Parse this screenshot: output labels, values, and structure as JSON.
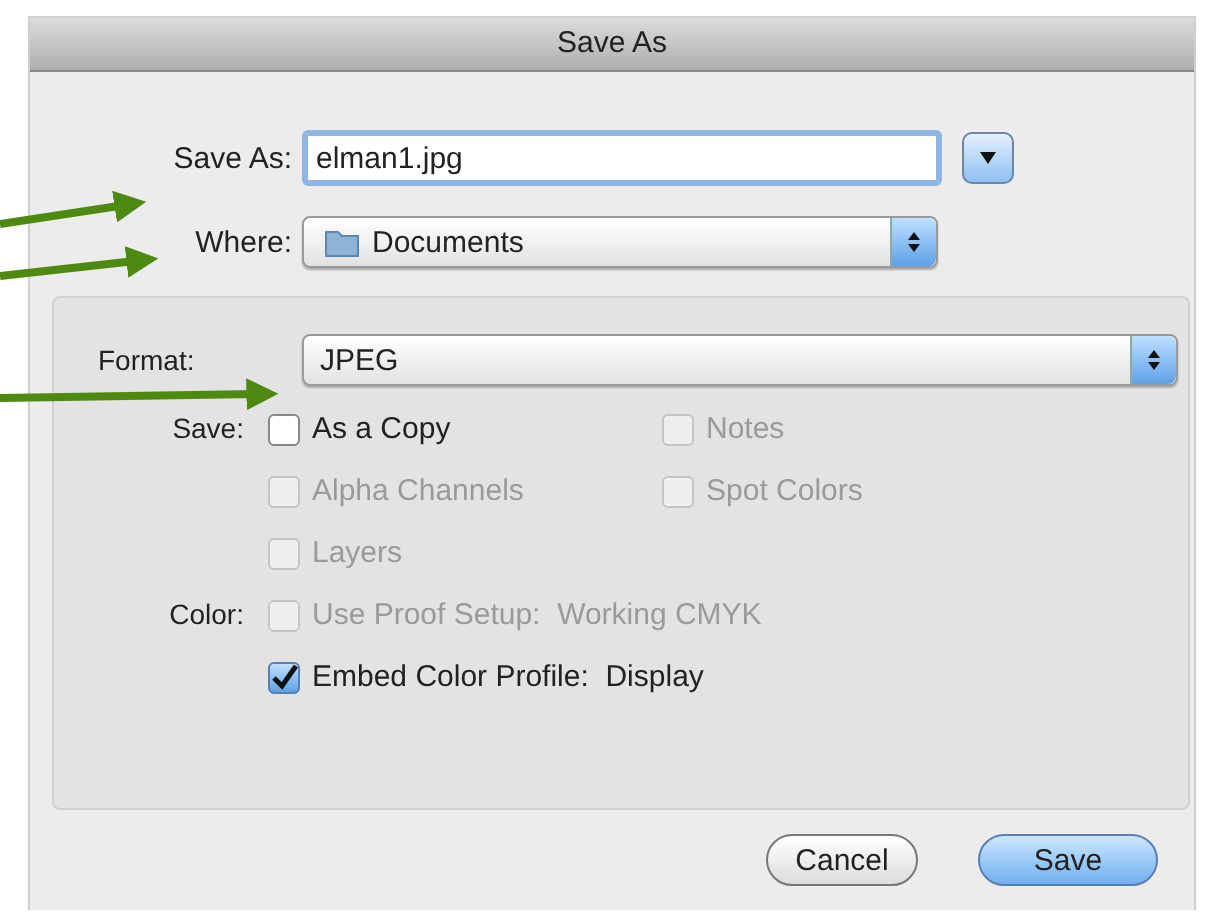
{
  "window": {
    "title": "Save As"
  },
  "save_as": {
    "label": "Save As:",
    "value": "elman1.jpg"
  },
  "where": {
    "label": "Where:",
    "value": "Documents"
  },
  "format": {
    "label": "Format:",
    "value": "JPEG"
  },
  "option_rows": [
    {
      "label": "Save:",
      "options": [
        {
          "label": "As a Copy",
          "checked": false,
          "disabled": false
        },
        {
          "label": "Notes",
          "checked": false,
          "disabled": true
        }
      ]
    },
    {
      "options": [
        {
          "label": "Alpha Channels",
          "checked": false,
          "disabled": true
        },
        {
          "label": "Spot Colors",
          "checked": false,
          "disabled": true
        }
      ]
    },
    {
      "options": [
        {
          "label": "Layers",
          "checked": false,
          "disabled": true
        }
      ]
    },
    {
      "label": "Color:",
      "options": [
        {
          "label": "Use Proof Setup:  Working CMYK",
          "checked": false,
          "disabled": true
        }
      ]
    },
    {
      "options": [
        {
          "label": "Embed Color Profile:  Display",
          "checked": true,
          "disabled": false
        }
      ]
    }
  ],
  "buttons": [
    {
      "label": "Cancel",
      "kind": "normal"
    },
    {
      "label": "Save",
      "kind": "default"
    }
  ]
}
